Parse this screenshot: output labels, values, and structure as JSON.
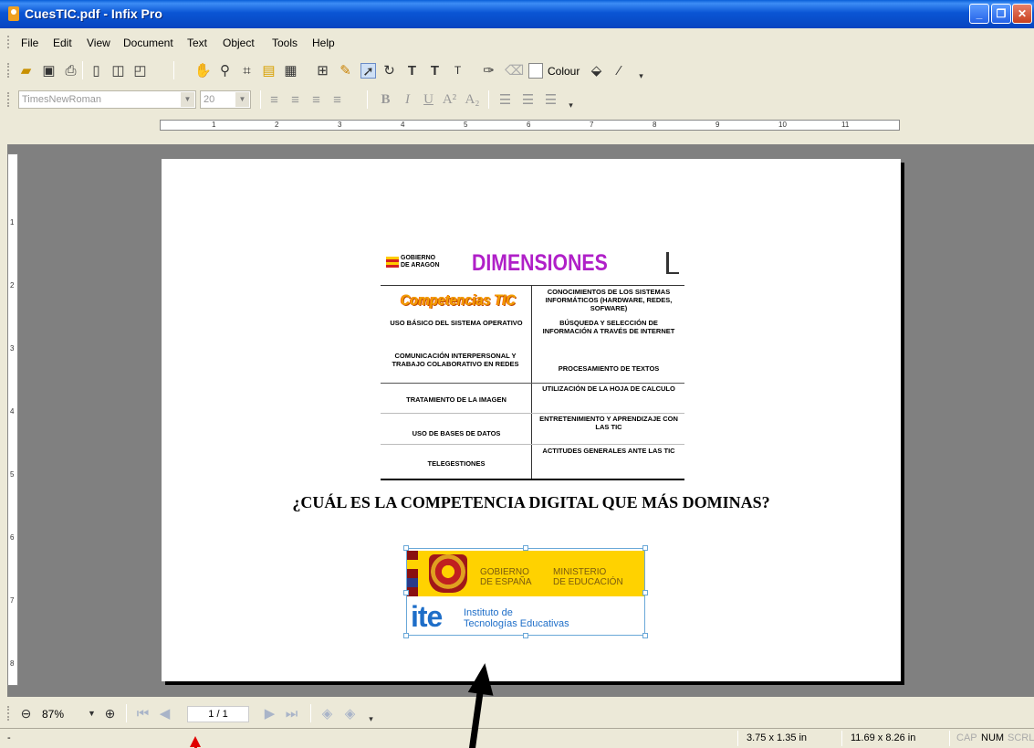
{
  "window": {
    "title": "CuesTIC.pdf - Infix Pro",
    "minimize": "_",
    "restore": "❐",
    "close": "✕"
  },
  "menu": [
    "File",
    "Edit",
    "View",
    "Document",
    "Text",
    "Object",
    "Tools",
    "Help"
  ],
  "toolbar1": {
    "colour_label": "Colour"
  },
  "format_bar": {
    "font": "TimesNewRoman",
    "size": "20",
    "bold": "B",
    "italic": "I",
    "underline": "U"
  },
  "ruler": {
    "ticks": [
      "1",
      "2",
      "3",
      "4",
      "5",
      "6",
      "7",
      "8",
      "9",
      "10",
      "11"
    ]
  },
  "vruler": {
    "ticks": [
      "1",
      "2",
      "3",
      "4",
      "5",
      "6",
      "7",
      "8"
    ]
  },
  "slide": {
    "gobierno_line1": "GOBIERNO",
    "gobierno_line2": "DE ARAGON",
    "title": "DIMENSIONES",
    "competencias_logo": "Competencias TIC",
    "left_cells": [
      "USO BÁSICO DEL SISTEMA OPERATIVO",
      "COMUNICACIÓN INTERPERSONAL Y TRABAJO COLABORATIVO EN REDES",
      "TRATAMIENTO DE LA IMAGEN",
      "USO DE BASES DE DATOS",
      "TELEGESTIONES"
    ],
    "right_cells": [
      "CONOCIMIENTOS DE LOS SISTEMAS INFORMÁTICOS (HARDWARE, REDES, SOFWARE)",
      "BÚSQUEDA Y SELECCIÓN DE INFORMACIÓN A TRAVÉS DE INTERNET",
      "PROCESAMIENTO DE TEXTOS",
      "UTILIZACIÓN DE LA HOJA DE CALCULO",
      "ENTRETENIMIENTO Y APRENDIZAJE CON LAS TIC",
      "ACTITUDES GENERALES ANTE LAS TIC"
    ],
    "question": "¿CUÁL ES LA COMPETENCIA DIGITAL QUE MÁS DOMINAS?",
    "logo": {
      "gobierno": "GOBIERNO",
      "espana": "DE ESPAÑA",
      "ministerio": "MINISTERIO",
      "educacion": "DE EDUCACIÓN",
      "ite": "ite",
      "instituto1": "Instituto de",
      "instituto2": "Tecnologías Educativas"
    }
  },
  "nav": {
    "zoom": "87%",
    "page": "1 / 1"
  },
  "status": {
    "left": "-",
    "selection_size": "3.75 x 1.35 in",
    "page_size": "11.69 x 8.26 in",
    "cap": "CAP",
    "num": "NUM",
    "scrl": "SCRL"
  }
}
